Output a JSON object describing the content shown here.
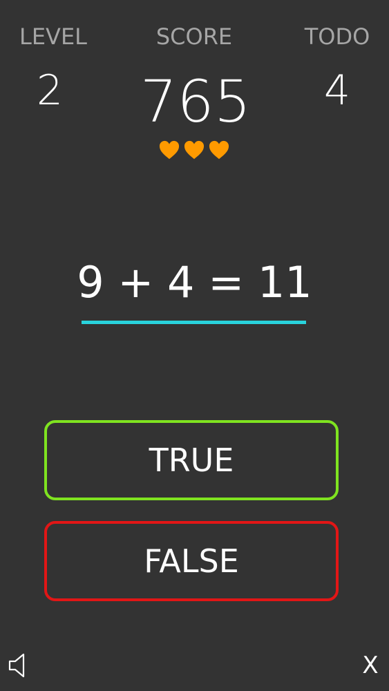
{
  "stats": {
    "level": {
      "label": "LEVEL",
      "value": "2"
    },
    "score": {
      "label": "SCORE",
      "value": "765"
    },
    "todo": {
      "label": "TODO",
      "value": "4"
    }
  },
  "lives": {
    "count": 3,
    "icon": "heart-icon",
    "color": "#ff9a00"
  },
  "equation": "9 + 4 = 11",
  "buttons": {
    "true_label": "TRUE",
    "false_label": "FALSE"
  },
  "colors": {
    "background": "#333333",
    "underline": "#29d3dd",
    "true_border": "#7fe320",
    "false_border": "#e21616"
  },
  "controls": {
    "sound_icon": "speaker-icon",
    "close_label": "X"
  }
}
